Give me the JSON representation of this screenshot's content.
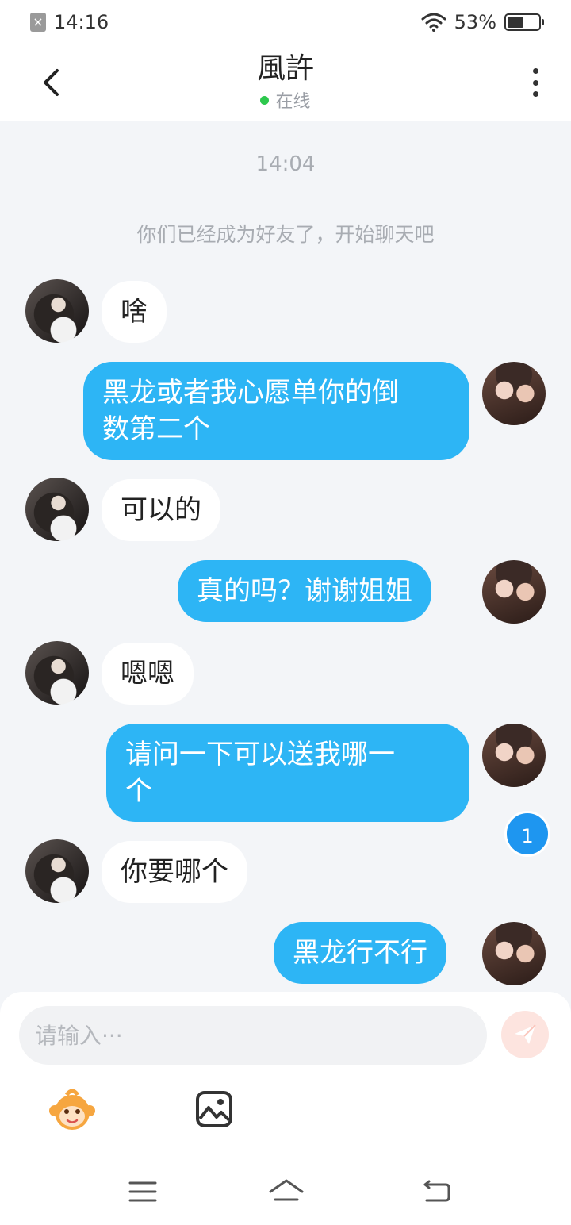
{
  "status_bar": {
    "time": "14:16",
    "battery_percent": "53%",
    "battery_level": 0.53
  },
  "header": {
    "title": "風許",
    "status": "在线",
    "back_icon": "chevron-left-icon",
    "more_icon": "more-vertical-icon"
  },
  "chat": {
    "timestamp": "14:04",
    "system_message": "你们已经成为好友了，开始聊天吧",
    "messages": [
      {
        "sender": "them",
        "text": "啥"
      },
      {
        "sender": "me",
        "line1": "黑龙或者我心愿单你的倒",
        "line2": "数第二个"
      },
      {
        "sender": "them",
        "text": "可以的"
      },
      {
        "sender": "me",
        "text": "真的吗？谢谢姐姐"
      },
      {
        "sender": "them",
        "text": "嗯嗯"
      },
      {
        "sender": "me",
        "line1": " 请问一下可以送我哪一",
        "line2": "个"
      },
      {
        "sender": "them",
        "text": "你要哪个"
      },
      {
        "sender": "me",
        "text": "黑龙行不行"
      }
    ],
    "unread_count": "1"
  },
  "input": {
    "placeholder": "请输入···",
    "value": ""
  },
  "toolbar": {
    "emoji_icon": "monkey-emoji-icon",
    "image_icon": "image-gallery-icon",
    "send_icon": "paper-plane-icon"
  },
  "colors": {
    "my_bubble": "#2db5f5",
    "their_bubble": "#ffffff",
    "online_dot": "#2dc84d",
    "badge": "#1e96f0"
  }
}
